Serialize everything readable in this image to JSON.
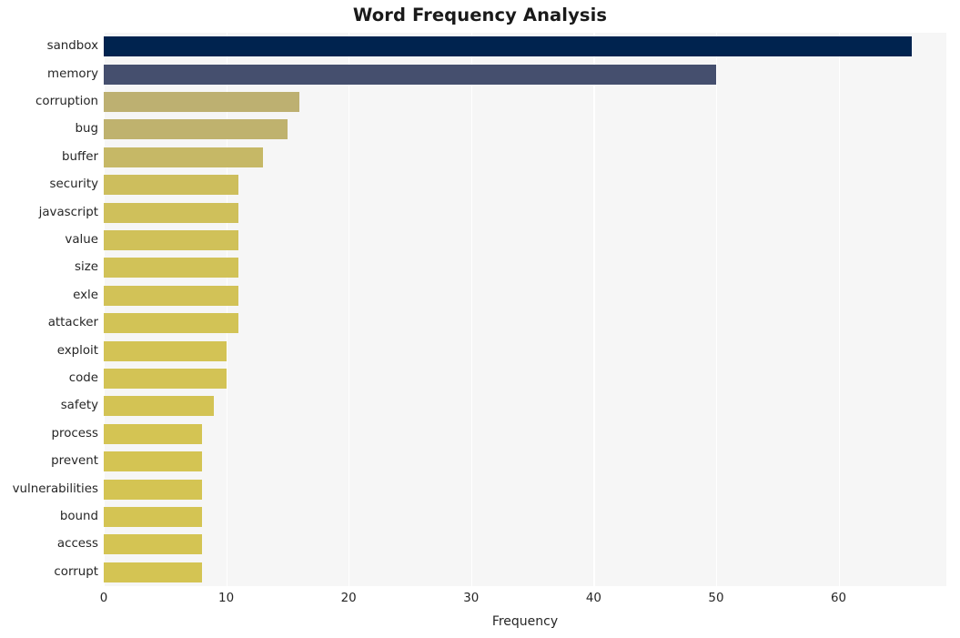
{
  "chart_data": {
    "type": "bar",
    "orientation": "horizontal",
    "title": "Word Frequency Analysis",
    "xlabel": "Frequency",
    "ylabel": "",
    "categories": [
      "sandbox",
      "memory",
      "corruption",
      "bug",
      "buffer",
      "security",
      "javascript",
      "value",
      "size",
      "exle",
      "attacker",
      "exploit",
      "code",
      "safety",
      "process",
      "prevent",
      "vulnerabilities",
      "bound",
      "access",
      "corrupt"
    ],
    "values": [
      66,
      50,
      16,
      15,
      13,
      11,
      11,
      11,
      11,
      11,
      11,
      10,
      10,
      9,
      8,
      8,
      8,
      8,
      8,
      8
    ],
    "bar_colors": [
      "#00234f",
      "#454f6e",
      "#bdb071",
      "#bfb26e",
      "#c6b866",
      "#cdbe5d",
      "#cfc05b",
      "#d0c159",
      "#d1c258",
      "#d2c257",
      "#d2c356",
      "#d3c355",
      "#d3c355",
      "#d3c354",
      "#d4c453",
      "#d4c453",
      "#d4c453",
      "#d4c453",
      "#d4c453",
      "#d4c453"
    ],
    "xticks": [
      0,
      10,
      20,
      30,
      40,
      50,
      60
    ],
    "xticklabels": [
      "0",
      "10",
      "20",
      "30",
      "40",
      "50",
      "60"
    ],
    "xlim": [
      0,
      68.8
    ],
    "grid": true,
    "grid_axis": "x",
    "legend": null,
    "plot_background": "#f6f6f6",
    "figure_background": "#ffffff",
    "gridline_color": "#ffffff"
  }
}
